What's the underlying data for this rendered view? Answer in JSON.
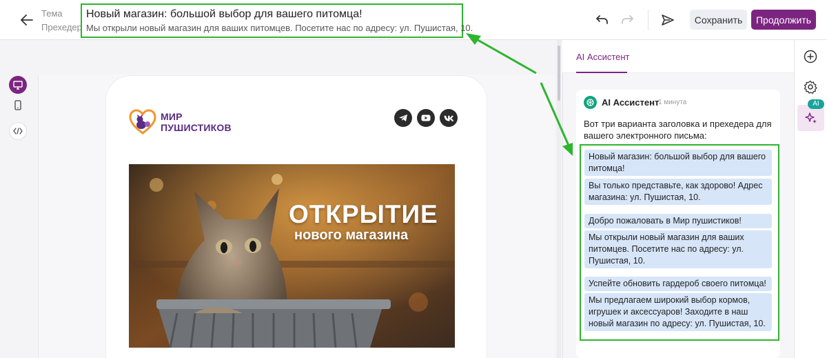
{
  "header": {
    "theme_label": "Тема",
    "preheader_label": "Прехедер",
    "subject": "Новый магазин: большой выбор для вашего питомца!",
    "preheader": "Мы открыли новый магазин для ваших питомцев. Посетите нас по адресу: ул. Пушистая, 10.",
    "save_label": "Сохранить",
    "continue_label": "Продолжить",
    "icons": [
      "back-arrow-icon",
      "undo-icon",
      "redo-icon",
      "send-test-icon"
    ]
  },
  "tools": [
    "desktop-icon",
    "mobile-icon",
    "code-icon"
  ],
  "email": {
    "logo_line1": "МИР",
    "logo_line2": "ПУШИСТИКОВ",
    "social": [
      "telegram-icon",
      "youtube-icon",
      "vk-icon"
    ],
    "hero_title": "ОТКРЫТИЕ",
    "hero_subtitle": "нового магазина"
  },
  "ai_panel": {
    "tab_label": "AI Ассистент",
    "assistant_name": "AI Ассистент",
    "time": "1 минута",
    "intro": "Вот три варианта заголовка и прехедера для вашего электронного письма:",
    "options": [
      "Новый магазин: большой выбор для вашего питомца!",
      "Вы только представьте, как здорово! Адрес магазина: ул. Пушистая, 10.",
      "Добро пожаловать в Мир пушистиков!",
      "Мы открыли новый магазин для ваших питомцев. Посетите нас по адресу: ул. Пушистая, 10.",
      "Успейте обновить гардероб своего питомца!",
      "Мы предлагаем широкий выбор кормов, игрушек и аксессуаров! Заходите в наш новый магазин по адресу: ул. Пушистая, 10."
    ]
  },
  "rail": {
    "ai_badge": "AI",
    "icons": [
      "add-icon",
      "settings-icon",
      "ai-sparkle-icon"
    ]
  },
  "colors": {
    "accent": "#7b2580",
    "highlight": "#2db52d",
    "option_bg": "#d7e5f8",
    "ai_badge": "#1aa39b"
  }
}
